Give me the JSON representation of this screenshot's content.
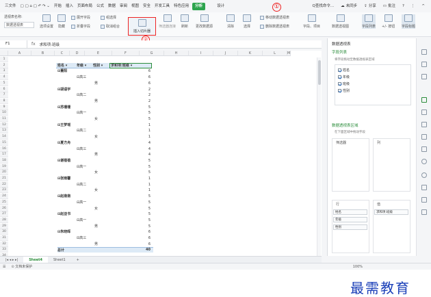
{
  "menubar": {
    "file": "三文件",
    "items": [
      "开始",
      "插入",
      "页面布局",
      "公式",
      "数据",
      "审阅",
      "视图",
      "安全",
      "开发工具",
      "特色应用"
    ],
    "active_tab": "分析",
    "design_tab": "设计",
    "search": "Q查找命令...",
    "sync": "未同步",
    "share": "分享",
    "comment": "批注"
  },
  "badges": {
    "one": "①",
    "two": "②"
  },
  "ribbon": {
    "pivot_name_label": "透视表名称:",
    "pivot_name_value": "数据透视表",
    "pivot_options": "选项设置",
    "hide": "隐藏",
    "expand_field": "展开字段",
    "collapse_field": "折叠字段",
    "group_selection": "组选择",
    "ungroup": "取消组合",
    "insert_slicer": "插入切片器",
    "filter_connection": "筛选器连接",
    "refresh": "刷新",
    "change_source": "更改数据源",
    "clear": "清除",
    "select": "选择",
    "move_pivot": "移动数据透视表",
    "delete_pivot": "删除数据透视表",
    "fields_items": "字段、项目",
    "pivot_chart": "数据透视图",
    "field_list": "字段列表",
    "plus_minus": "+/- 按钮",
    "field_headers": "字段标题"
  },
  "formula_bar": {
    "cell_ref": "F1",
    "fx": "fx",
    "content": "求和项:班级"
  },
  "columns": [
    "A",
    "B",
    "C",
    "D",
    "E",
    "F",
    "G",
    "H",
    "I",
    "J",
    "K",
    "L",
    "M"
  ],
  "pivot": {
    "header_name": "姓名",
    "header_grade": "年级",
    "header_gender": "性别",
    "header_sum": "求和项:班级",
    "rows": [
      {
        "name": "董阳",
        "grade": "",
        "gender": "",
        "value": "6"
      },
      {
        "name": "",
        "grade": "高三",
        "gender": "",
        "value": "6"
      },
      {
        "name": "",
        "grade": "",
        "gender": "男",
        "value": "6"
      },
      {
        "name": "胡语宇",
        "grade": "",
        "gender": "",
        "value": "2"
      },
      {
        "name": "",
        "grade": "高二",
        "gender": "",
        "value": "2"
      },
      {
        "name": "",
        "grade": "",
        "gender": "男",
        "value": "2"
      },
      {
        "name": "苏珊珊",
        "grade": "",
        "gender": "",
        "value": "5"
      },
      {
        "name": "",
        "grade": "高一",
        "gender": "",
        "value": "5"
      },
      {
        "name": "",
        "grade": "",
        "gender": "女",
        "value": "5"
      },
      {
        "name": "王梦瑶",
        "grade": "",
        "gender": "",
        "value": "1"
      },
      {
        "name": "",
        "grade": "高二",
        "gender": "",
        "value": "1"
      },
      {
        "name": "",
        "grade": "",
        "gender": "女",
        "value": "1"
      },
      {
        "name": "夏方舟",
        "grade": "",
        "gender": "",
        "value": "4"
      },
      {
        "name": "",
        "grade": "高三",
        "gender": "",
        "value": "4"
      },
      {
        "name": "",
        "grade": "",
        "gender": "男",
        "value": "4"
      },
      {
        "name": "谢蓓蓓",
        "grade": "",
        "gender": "",
        "value": "5"
      },
      {
        "name": "",
        "grade": "高一",
        "gender": "",
        "value": "5"
      },
      {
        "name": "",
        "grade": "",
        "gender": "女",
        "value": "5"
      },
      {
        "name": "张雨馨",
        "grade": "",
        "gender": "",
        "value": "1"
      },
      {
        "name": "",
        "grade": "高二",
        "gender": "",
        "value": "1"
      },
      {
        "name": "",
        "grade": "",
        "gender": "女",
        "value": "1"
      },
      {
        "name": "赵南南",
        "grade": "",
        "gender": "",
        "value": "5"
      },
      {
        "name": "",
        "grade": "高一",
        "gender": "",
        "value": "5"
      },
      {
        "name": "",
        "grade": "",
        "gender": "女",
        "value": "5"
      },
      {
        "name": "赵亚书",
        "grade": "",
        "gender": "",
        "value": "5"
      },
      {
        "name": "",
        "grade": "高一",
        "gender": "",
        "value": "5"
      },
      {
        "name": "",
        "grade": "",
        "gender": "男",
        "value": "5"
      },
      {
        "name": "朱晓晖",
        "grade": "",
        "gender": "",
        "value": "6"
      },
      {
        "name": "",
        "grade": "高三",
        "gender": "",
        "value": "6"
      },
      {
        "name": "",
        "grade": "",
        "gender": "男",
        "value": "6"
      }
    ],
    "total_label": "总计",
    "total_value": "40"
  },
  "sheet_tabs": [
    "Sheet4",
    "Sheet1"
  ],
  "status": {
    "doc_protect": "文档未保护",
    "zoom": "100%"
  },
  "panel": {
    "title": "数据透视表",
    "field_list_title": "字段列表",
    "field_list_hint": "将字段拖动至数据透视表区域",
    "fields": [
      "姓名",
      "年级",
      "班级",
      "性别"
    ],
    "areas_title": "数据透视表区域",
    "areas_hint": "在下面区域中拖动字段",
    "filter": "筛选器",
    "columns": "列",
    "rows": "行",
    "values": "值",
    "row_fields": [
      "姓名",
      "年级",
      "性别"
    ],
    "value_fields": [
      "求和项:班级"
    ]
  },
  "watermark": "最需教育",
  "colors": {
    "accent": "#2da44e",
    "highlight": "#e22222"
  }
}
